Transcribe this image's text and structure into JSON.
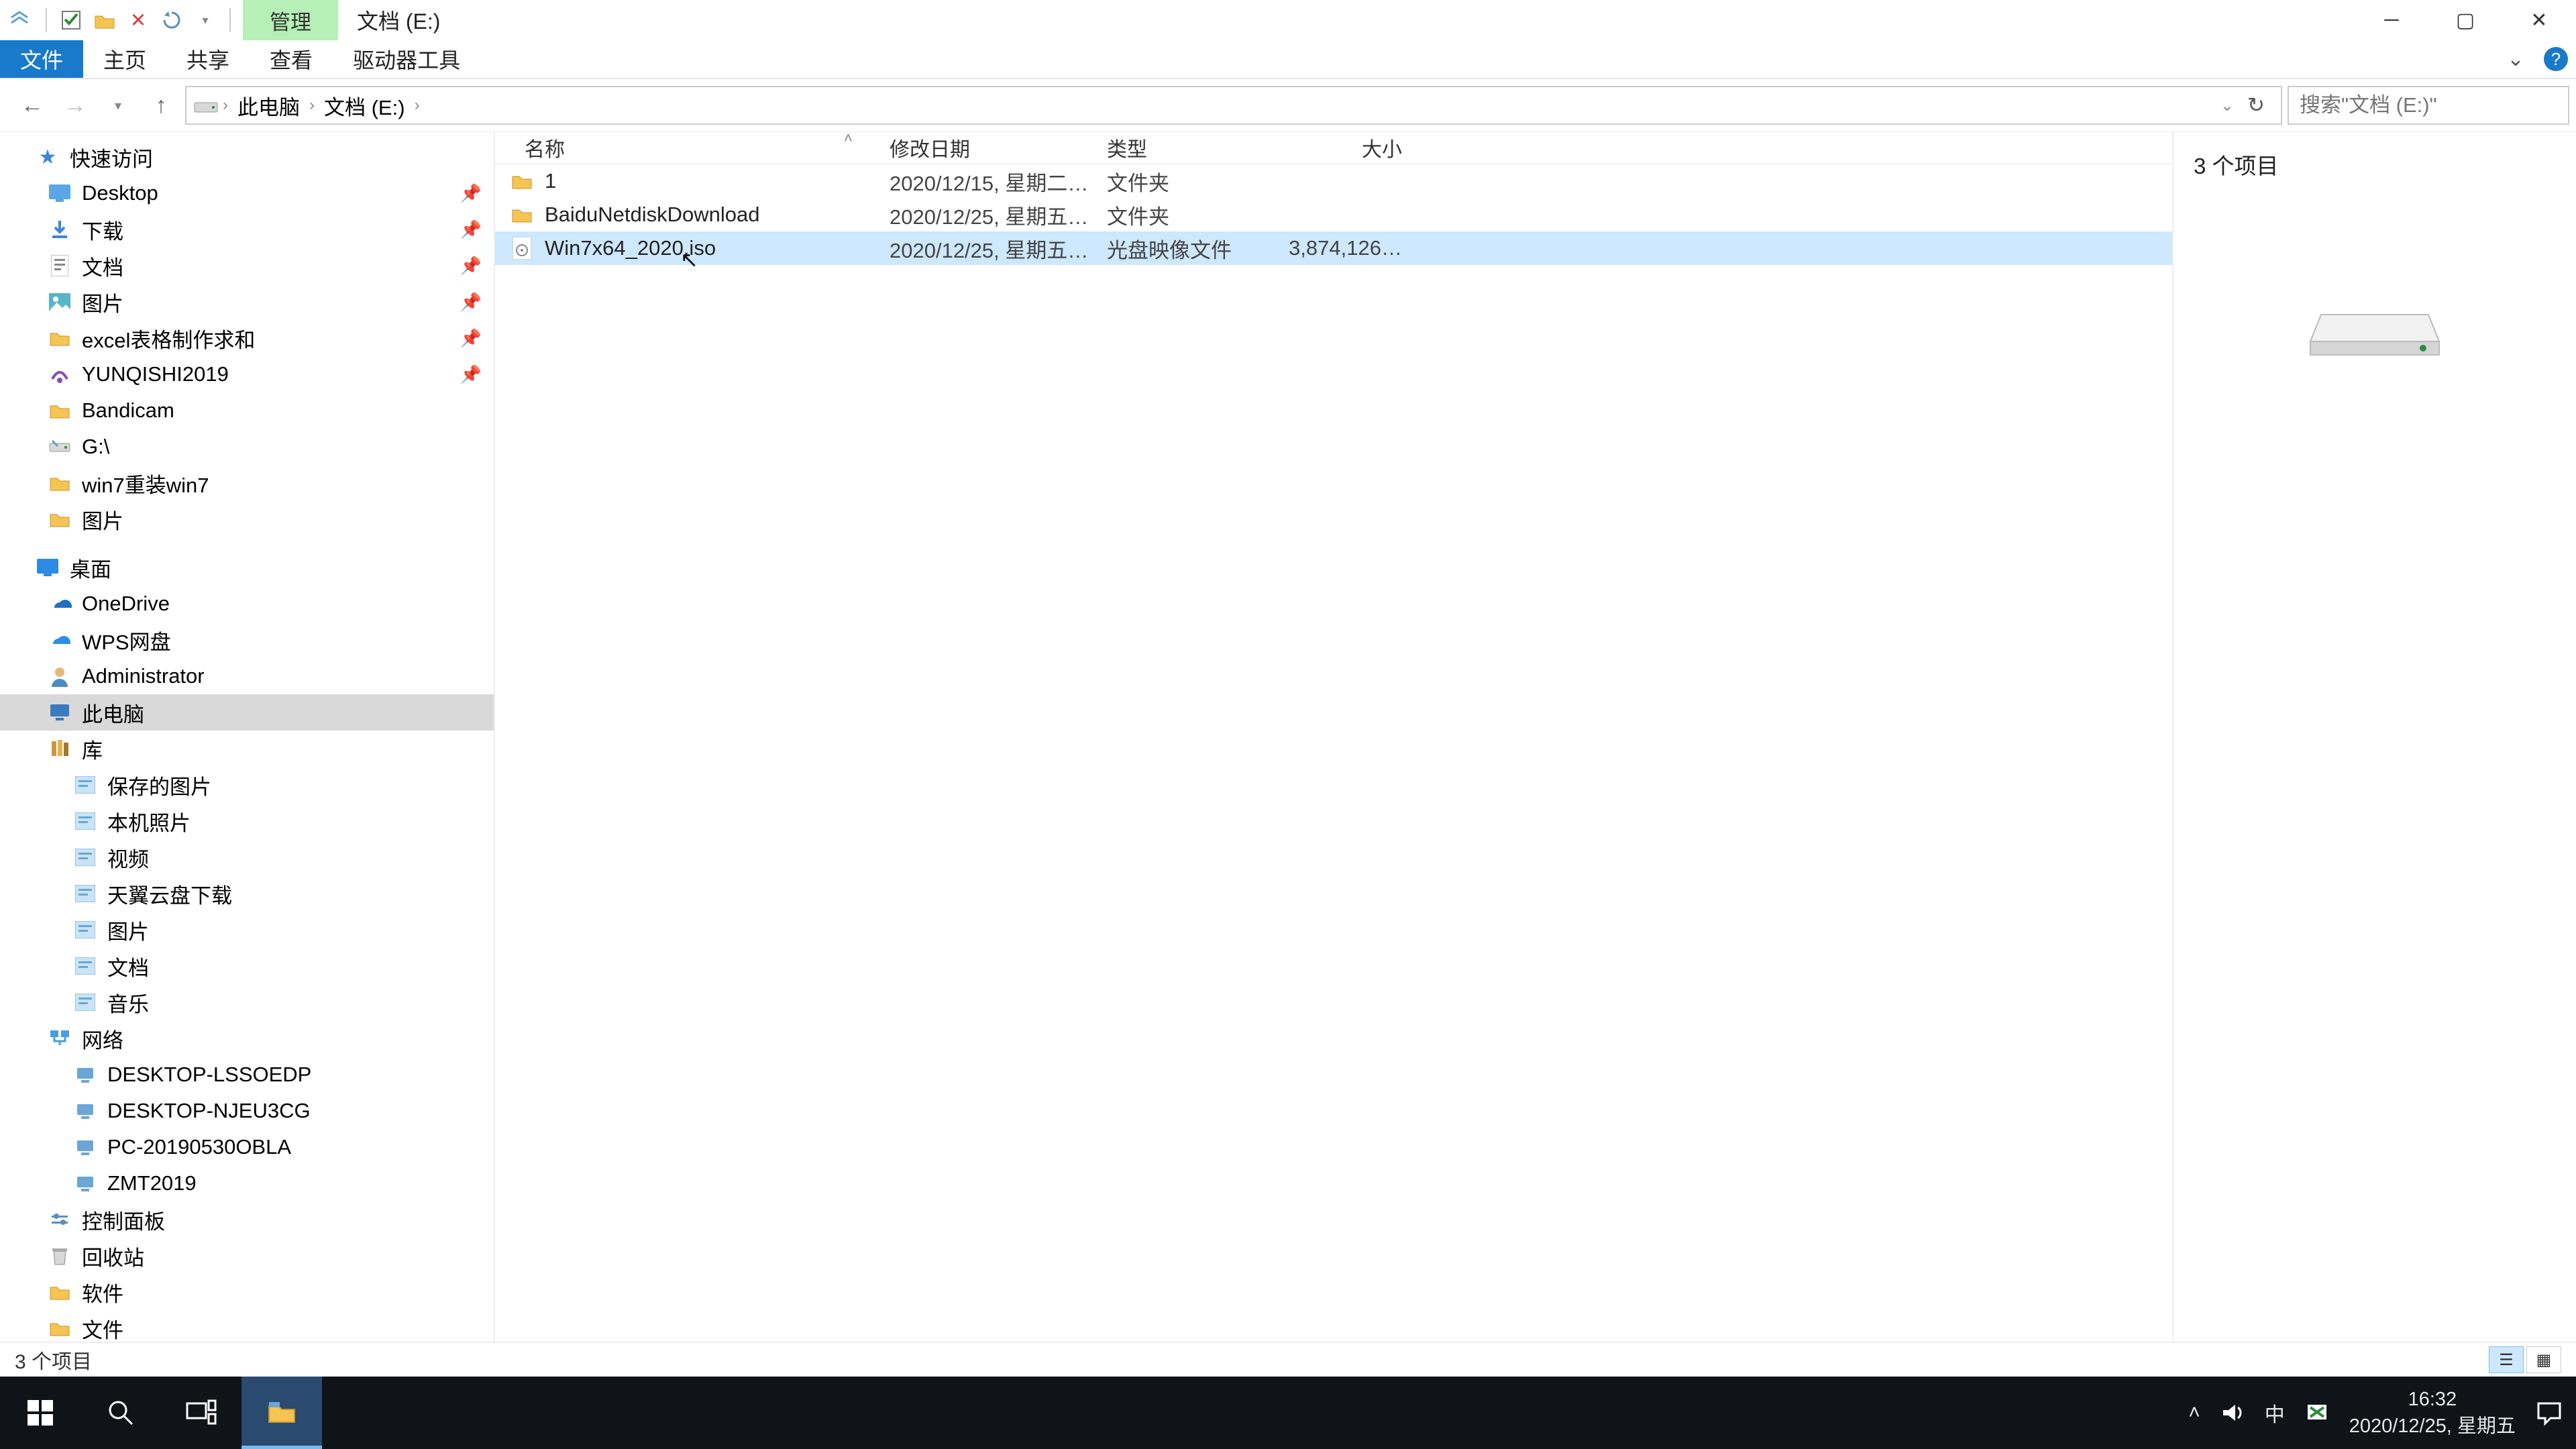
{
  "title_path": "文档 (E:)",
  "ribbon_context": "管理",
  "tabs": {
    "file": "文件",
    "home": "主页",
    "share": "共享",
    "view": "查看",
    "drive": "驱动器工具"
  },
  "breadcrumb": [
    "此电脑",
    "文档 (E:)"
  ],
  "search_placeholder": "搜索\"文档 (E:)\"",
  "columns": {
    "name": "名称",
    "date": "修改日期",
    "type": "类型",
    "size": "大小"
  },
  "rows": [
    {
      "name": "1",
      "date": "2020/12/15, 星期二 1…",
      "type": "文件夹",
      "size": "",
      "kind": "folder",
      "sel": false
    },
    {
      "name": "BaiduNetdiskDownload",
      "date": "2020/12/25, 星期五 1…",
      "type": "文件夹",
      "size": "",
      "kind": "folder",
      "sel": false
    },
    {
      "name": "Win7x64_2020.iso",
      "date": "2020/12/25, 星期五 1…",
      "type": "光盘映像文件",
      "size": "3,874,126…",
      "kind": "iso",
      "sel": true
    }
  ],
  "tree": {
    "quick": "快速访问",
    "quick_items": [
      {
        "label": "Desktop",
        "pin": true,
        "ico": "desk"
      },
      {
        "label": "下载",
        "pin": true,
        "ico": "dl"
      },
      {
        "label": "文档",
        "pin": true,
        "ico": "doc"
      },
      {
        "label": "图片",
        "pin": true,
        "ico": "pic"
      },
      {
        "label": "excel表格制作求和",
        "pin": true,
        "ico": "fold"
      },
      {
        "label": "YUNQISHI2019",
        "pin": true,
        "ico": "yq"
      },
      {
        "label": "Bandicam",
        "pin": false,
        "ico": "fold"
      },
      {
        "label": "G:\\",
        "pin": false,
        "ico": "gdr"
      },
      {
        "label": "win7重装win7",
        "pin": false,
        "ico": "fold"
      },
      {
        "label": "图片",
        "pin": false,
        "ico": "fold"
      }
    ],
    "desktop": "桌面",
    "desktop_items": [
      {
        "label": "OneDrive",
        "ico": "od"
      },
      {
        "label": "WPS网盘",
        "ico": "wps"
      },
      {
        "label": "Administrator",
        "ico": "user"
      },
      {
        "label": "此电脑",
        "ico": "pc",
        "sel": true
      },
      {
        "label": "库",
        "ico": "lib"
      }
    ],
    "lib_items": [
      {
        "label": "保存的图片"
      },
      {
        "label": "本机照片"
      },
      {
        "label": "视频"
      },
      {
        "label": "天翼云盘下载"
      },
      {
        "label": "图片"
      },
      {
        "label": "文档"
      },
      {
        "label": "音乐"
      }
    ],
    "network": "网络",
    "net_items": [
      {
        "label": "DESKTOP-LSSOEDP"
      },
      {
        "label": "DESKTOP-NJEU3CG"
      },
      {
        "label": "PC-20190530OBLA"
      },
      {
        "label": "ZMT2019"
      }
    ],
    "tail": [
      {
        "label": "控制面板",
        "ico": "cp"
      },
      {
        "label": "回收站",
        "ico": "bin"
      },
      {
        "label": "软件",
        "ico": "fold"
      },
      {
        "label": "文件",
        "ico": "fold"
      }
    ]
  },
  "preview_count": "3 个项目",
  "status_text": "3 个项目",
  "taskbar": {
    "time": "16:32",
    "date": "2020/12/25, 星期五",
    "ime": "中"
  }
}
